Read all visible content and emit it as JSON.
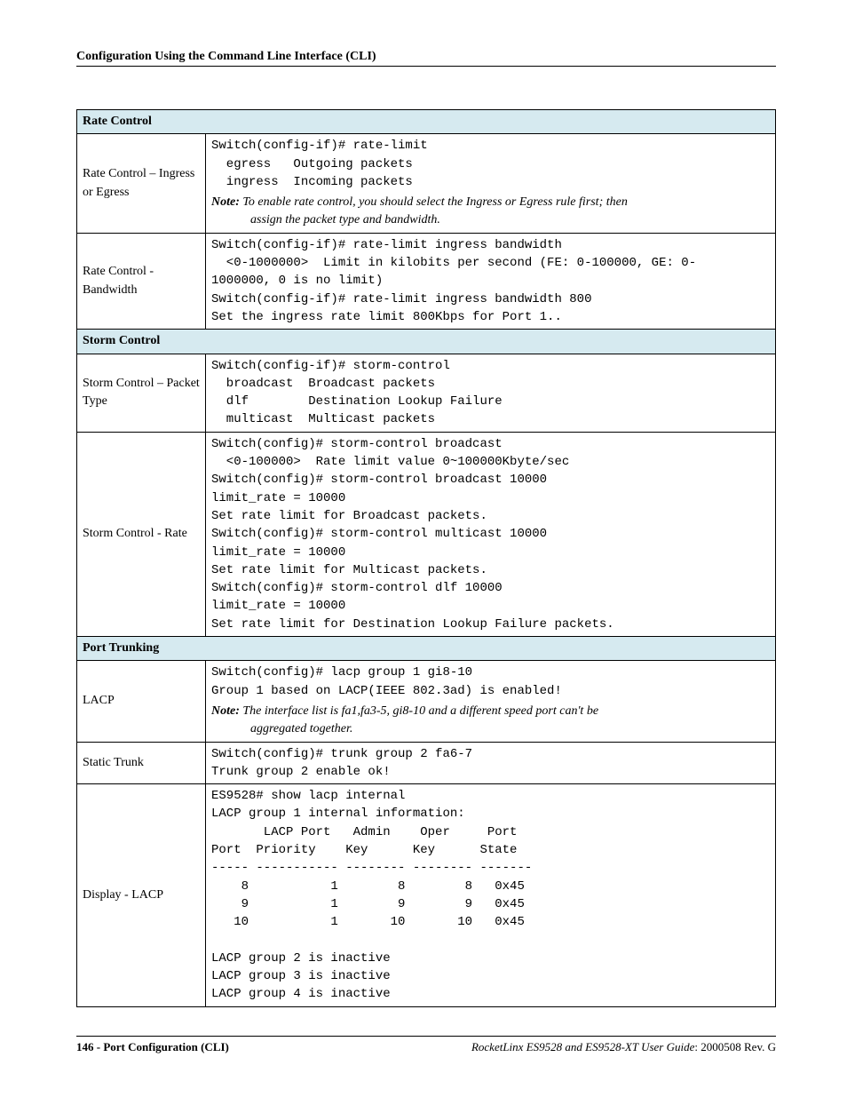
{
  "header": "Configuration Using the Command Line Interface (CLI)",
  "sections": {
    "rate_control": {
      "title": "Rate Control",
      "rows": {
        "ingress_egress": {
          "label": "Rate Control – Ingress or Egress",
          "text": "Switch(config-if)# rate-limit\n  egress   Outgoing packets\n  ingress  Incoming packets",
          "note_bold": "Note:",
          "note_body": " To enable rate control, you should select the Ingress or Egress rule first; then",
          "note_cont": "assign the packet type and bandwidth."
        },
        "bandwidth": {
          "label": "Rate Control - Bandwidth",
          "text": "Switch(config-if)# rate-limit ingress bandwidth\n  <0-1000000>  Limit in kilobits per second (FE: 0-100000, GE: 0-\n1000000, 0 is no limit)\nSwitch(config-if)# rate-limit ingress bandwidth 800\nSet the ingress rate limit 800Kbps for Port 1.."
        }
      }
    },
    "storm_control": {
      "title": "Storm Control",
      "rows": {
        "packet_type": {
          "label": "Storm Control – Packet Type",
          "text": "Switch(config-if)# storm-control\n  broadcast  Broadcast packets\n  dlf        Destination Lookup Failure\n  multicast  Multicast packets"
        },
        "rate": {
          "label": "Storm Control - Rate",
          "text": "Switch(config)# storm-control broadcast\n  <0-100000>  Rate limit value 0~100000Kbyte/sec\nSwitch(config)# storm-control broadcast 10000\nlimit_rate = 10000\nSet rate limit for Broadcast packets.\nSwitch(config)# storm-control multicast 10000\nlimit_rate = 10000\nSet rate limit for Multicast packets.\nSwitch(config)# storm-control dlf 10000\nlimit_rate = 10000\nSet rate limit for Destination Lookup Failure packets."
        }
      }
    },
    "port_trunking": {
      "title": "Port Trunking",
      "rows": {
        "lacp": {
          "label": "LACP",
          "text": "Switch(config)# lacp group 1 gi8-10\nGroup 1 based on LACP(IEEE 802.3ad) is enabled!",
          "note_bold": "Note:",
          "note_body": " The interface list is fa1,fa3-5, gi8-10 and a different speed port can't be",
          "note_cont": "aggregated together."
        },
        "static_trunk": {
          "label": "Static Trunk",
          "text": "Switch(config)# trunk group 2 fa6-7\nTrunk group 2 enable ok!"
        },
        "display_lacp": {
          "label": "Display - LACP",
          "text": "ES9528# show lacp internal\nLACP group 1 internal information:\n       LACP Port   Admin    Oper     Port\nPort  Priority    Key      Key      State\n----- ----------- -------- -------- -------\n    8           1        8        8   0x45\n    9           1        9        9   0x45\n   10           1       10       10   0x45\n\nLACP group 2 is inactive\nLACP group 3 is inactive\nLACP group 4 is inactive"
        }
      }
    }
  },
  "footer": {
    "left": "146 - Port Configuration (CLI)",
    "right_italic": "RocketLinx ES9528 and ES9528-XT User Guide",
    "right_rev": ": 2000508 Rev. G"
  }
}
